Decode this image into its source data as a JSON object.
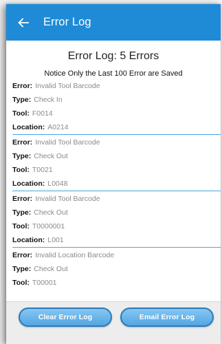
{
  "header": {
    "title": "Error Log",
    "back_icon": "back-arrow-icon"
  },
  "summary": {
    "heading": "Error Log: 5 Errors",
    "notice": "Notice Only the Last 100 Error are Saved"
  },
  "labels": {
    "error": "Error:",
    "type": "Type:",
    "tool": "Tool:",
    "location": "Location:"
  },
  "errors": [
    {
      "error": "Invalid Tool Barcode",
      "type": "Check In",
      "tool": "F0014",
      "location": "A0214"
    },
    {
      "error": "Invalid Tool Barcode",
      "type": "Check Out",
      "tool": "T0021",
      "location": "L0048"
    },
    {
      "error": "Invalid Tool Barcode",
      "type": "Check Out",
      "tool": "T0000001",
      "location": "L001"
    },
    {
      "error": "Invalid Location Barcode",
      "type": "Check Out",
      "tool": "T00001"
    }
  ],
  "buttons": {
    "clear": "Clear Error Log",
    "email": "Email Error Log"
  },
  "colors": {
    "app_bar": "#1f8bd6",
    "divider": "#4aa3e6",
    "button": "#54a6e2"
  }
}
